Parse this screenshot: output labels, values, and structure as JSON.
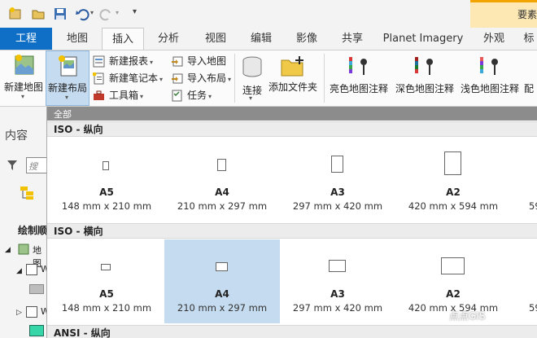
{
  "titlebar": {
    "right_label": "要素"
  },
  "tabs": [
    {
      "label": "工程"
    },
    {
      "label": "地图"
    },
    {
      "label": "插入"
    },
    {
      "label": "分析"
    },
    {
      "label": "视图"
    },
    {
      "label": "编辑"
    },
    {
      "label": "影像"
    },
    {
      "label": "共享"
    },
    {
      "label": "Planet Imagery"
    },
    {
      "label": "外观"
    },
    {
      "label": "标"
    }
  ],
  "ribbon": {
    "new_map": "新建地图",
    "new_layout": "新建布局",
    "new_report": "新建报表",
    "new_notebook": "新建笔记本",
    "toolbox": "工具箱",
    "import_map": "导入地图",
    "import_layout": "导入布局",
    "task": "任务",
    "connect": "连接",
    "add_folder": "添加文件夹",
    "bright_annot": "亮色地图注释",
    "dark_annot": "深色地图注释",
    "light_annot": "浅色地图注释",
    "more": "配"
  },
  "leftpane": {
    "contents": "内容",
    "search_placeholder": "搜索",
    "drawing_order": "绘制顺",
    "map_item": "地图",
    "item_w1": "W",
    "item_w2": "W"
  },
  "gallery": {
    "filter": "全部",
    "sections": [
      {
        "title": "ISO - 纵向"
      },
      {
        "title": "ISO - 横向"
      },
      {
        "title": "ANSI - 纵向"
      }
    ],
    "portrait": [
      {
        "name": "A5",
        "size": "148 mm x 210 mm"
      },
      {
        "name": "A4",
        "size": "210 mm x 297 mm"
      },
      {
        "name": "A3",
        "size": "297 mm x 420 mm"
      },
      {
        "name": "A2",
        "size": "420 mm x 594 mm"
      },
      {
        "name": "",
        "size": "59"
      }
    ],
    "landscape": [
      {
        "name": "A5",
        "size": "148 mm x 210 mm"
      },
      {
        "name": "A4",
        "size": "210 mm x 297 mm"
      },
      {
        "name": "A3",
        "size": "297 mm x 420 mm"
      },
      {
        "name": "A2",
        "size": "420 mm x 594 mm"
      },
      {
        "name": "",
        "size": "59"
      }
    ]
  },
  "watermark": "点点GIS",
  "colors": {
    "file_tab": "#0f6fc6",
    "selected": "#c5dbef",
    "accent_strip": "#f4a400"
  }
}
